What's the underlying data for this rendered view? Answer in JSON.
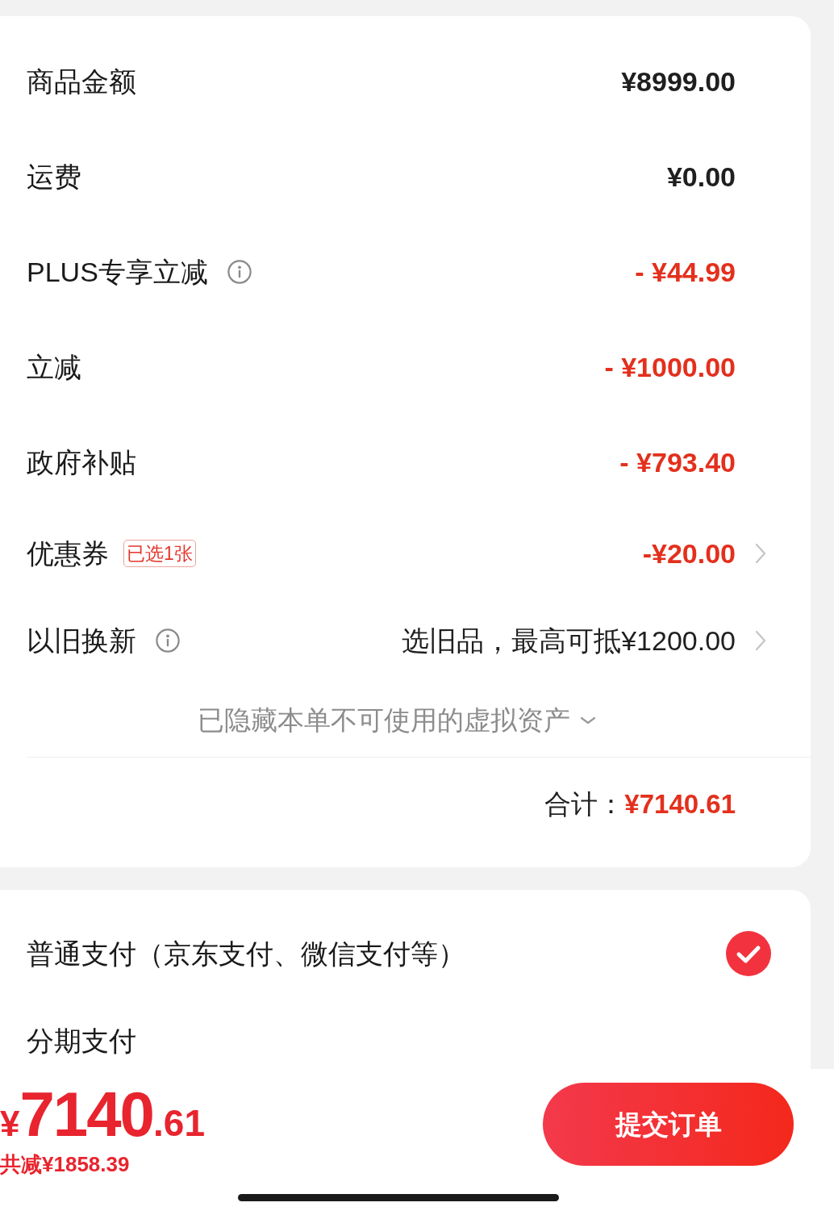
{
  "summary": {
    "rows": [
      {
        "label": "商品金额",
        "info": false,
        "value": "¥8999.00",
        "kind": "amount",
        "arrow": false
      },
      {
        "label": "运费",
        "info": false,
        "value": "¥0.00",
        "kind": "amount",
        "arrow": false
      },
      {
        "label": "PLUS专享立减",
        "info": true,
        "value": "- ¥44.99",
        "kind": "discount",
        "arrow": false
      },
      {
        "label": "立减",
        "info": false,
        "value": "- ¥1000.00",
        "kind": "discount",
        "arrow": false
      },
      {
        "label": "政府补贴",
        "info": false,
        "value": "- ¥793.40",
        "kind": "discount",
        "arrow": false
      },
      {
        "label": "优惠券",
        "info": false,
        "badge": "已选1张",
        "value": "-¥20.00",
        "kind": "discount",
        "arrow": true
      },
      {
        "label": "以旧换新",
        "info": true,
        "value": "选旧品，最高可抵¥1200.00",
        "kind": "note",
        "arrow": true
      }
    ],
    "hidden_assets": {
      "text": "已隐藏本单不可使用的虚拟资产",
      "expanded": false
    },
    "total": {
      "label": "合计：",
      "value": "¥7140.61"
    }
  },
  "payment": {
    "options": [
      {
        "label": "普通支付（京东支付、微信支付等）",
        "selected": true
      },
      {
        "label": "分期支付",
        "selected": false
      }
    ]
  },
  "checkout_bar": {
    "price": {
      "currency": "¥",
      "integer": "7140",
      "decimal": ".61"
    },
    "savings": "共减¥1858.39",
    "submit_button": "提交订单"
  }
}
